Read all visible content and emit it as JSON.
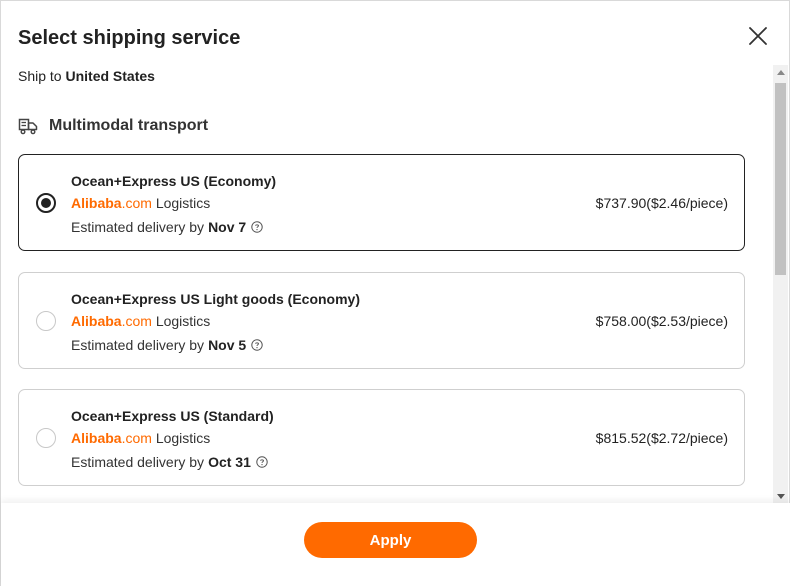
{
  "dialog": {
    "title": "Select shipping service",
    "ship_to_prefix": "Ship to",
    "ship_to_country": "United States",
    "close_icon": "close-icon"
  },
  "section": {
    "label": "Multimodal transport",
    "icon": "multimodal-truck-icon"
  },
  "options": [
    {
      "name": "Ocean+Express US (Economy)",
      "brand": "Alibaba",
      "brand_suffix": ".com",
      "carrier": "Logistics",
      "delivery_prefix": "Estimated delivery by",
      "delivery_date": "Nov 7",
      "price": "$737.90($2.46/piece)",
      "selected": true
    },
    {
      "name": "Ocean+Express US Light goods (Economy)",
      "brand": "Alibaba",
      "brand_suffix": ".com",
      "carrier": "Logistics",
      "delivery_prefix": "Estimated delivery by",
      "delivery_date": "Nov 5",
      "price": "$758.00($2.53/piece)",
      "selected": false
    },
    {
      "name": "Ocean+Express US (Standard)",
      "brand": "Alibaba",
      "brand_suffix": ".com",
      "carrier": "Logistics",
      "delivery_prefix": "Estimated delivery by",
      "delivery_date": "Oct 31",
      "price": "$815.52($2.72/piece)",
      "selected": false
    }
  ],
  "footer": {
    "apply_label": "Apply"
  },
  "colors": {
    "accent": "#ff6a00",
    "selected_border": "#222222",
    "card_border": "#cfcfcf"
  }
}
